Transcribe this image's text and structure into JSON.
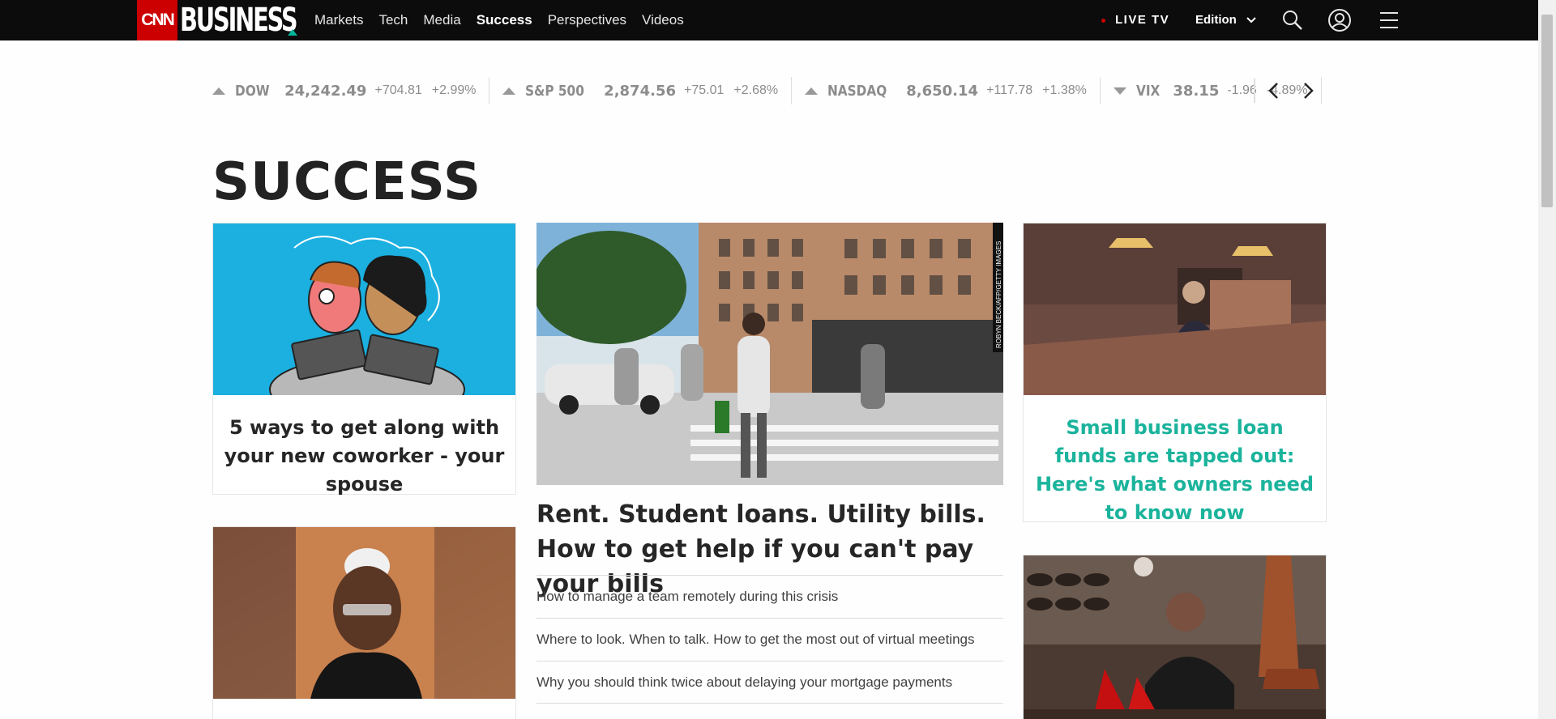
{
  "header": {
    "logo_cnn": "CNN",
    "logo_business": "BUSINESS",
    "nav": [
      "Markets",
      "Tech",
      "Media",
      "Success",
      "Perspectives",
      "Videos"
    ],
    "active_nav": "Success",
    "live_tv": "LIVE TV",
    "edition": "Edition"
  },
  "ticker": [
    {
      "symbol": "DOW",
      "value": "24,242.49",
      "change": "+704.81",
      "pct": "+2.99%",
      "direction": "up"
    },
    {
      "symbol": "S&P 500",
      "value": "2,874.56",
      "change": "+75.01",
      "pct": "+2.68%",
      "direction": "up"
    },
    {
      "symbol": "NASDAQ",
      "value": "8,650.14",
      "change": "+117.78",
      "pct": "+1.38%",
      "direction": "up"
    },
    {
      "symbol": "VIX",
      "value": "38.15",
      "change": "-1.96",
      "pct": "-4.89%",
      "direction": "down"
    }
  ],
  "page_title": "SUCCESS",
  "cards": {
    "left_top": {
      "headline": "5 ways to get along with your new coworker - your spouse"
    },
    "center": {
      "headline": "Rent. Student loans. Utility bills. How to get help if you can't pay your bills",
      "photo_credit": "ROBYN BECK/AFP/GETTY IMAGES",
      "related": [
        "How to manage a team remotely during this crisis",
        "Where to look. When to talk. How to get the most out of virtual meetings",
        "Why you should think twice about delaying your mortgage payments"
      ]
    },
    "right_top": {
      "headline": "Small business loan funds are tapped out: Here's what owners need to know now"
    }
  },
  "colors": {
    "accent_teal": "#1bb39c",
    "cnn_red": "#cc0000",
    "header_bg": "#0c0c0c"
  }
}
